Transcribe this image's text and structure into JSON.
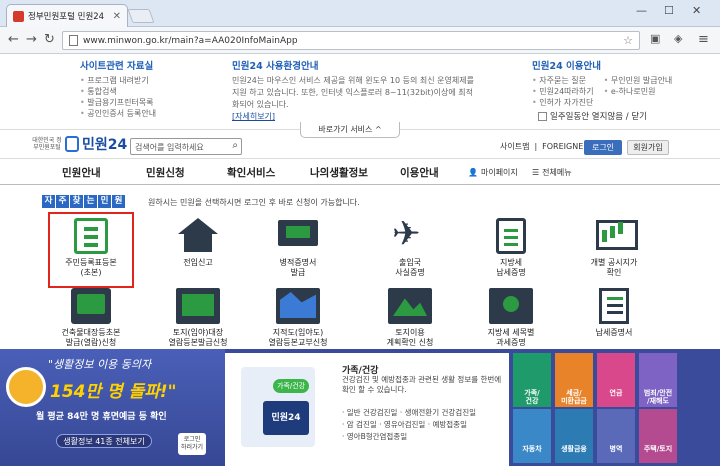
{
  "browser": {
    "tab_title": "정부민원포털 민원24",
    "url": "www.minwon.go.kr/main?a=AA020InfoMainApp"
  },
  "notice": {
    "site_materials": {
      "title": "사이트관련 자료실",
      "items": [
        "프로그램 내려받기",
        "통합검색",
        "발급용기프린터목록",
        "공인인증서 등록안내"
      ]
    },
    "env_guide": {
      "title": "민원24 사용환경안내",
      "text": "민원24는 마우스인 서비스 제공을 위해 윈도우 10 등의 최신 운영체제를 지원 하고 있습니다. 또한, 인터넷 익스플로러 8~11(32bit)이상에 최적화되어 있습니다.",
      "link": "[자세히보기]"
    },
    "usage_guide": {
      "title": "민원24 이용안내",
      "items_left": [
        "자주묻는 질문",
        "민원24따라하기",
        "인허가 자가진단"
      ],
      "items_right": [
        "무인민원 발급안내",
        "e-하나로민원"
      ]
    },
    "hide_today": "일주일동안 열지않음 / 닫기",
    "shortcut_service": "바로가기 서비스"
  },
  "header": {
    "logo_sub": "대한민국 정부민원포털",
    "logo_name": "민원24",
    "search_placeholder": "검색어를 입력하세요",
    "sitemap": "사이트맵",
    "foreigner": "FOREIGNER",
    "login": "로그인",
    "join": "회원가입"
  },
  "gnb": {
    "menus": [
      "민원안내",
      "민원신청",
      "확인서비스",
      "나의생활정보",
      "이용안내"
    ],
    "mypage": "마이페이지",
    "all_menu": "전체메뉴"
  },
  "frequent": {
    "title_chars": [
      "자",
      "주",
      "찾",
      "는",
      "민",
      "원"
    ],
    "desc": "원하시는 민원을 선택하시면 로그인 후 바로 신청이 가능합니다.",
    "row1": [
      {
        "label": "주민등록표등본\n(초본)",
        "icon": "resident-doc-icon"
      },
      {
        "label": "전입신고",
        "icon": "house-icon"
      },
      {
        "label": "병적증명서\n발급",
        "icon": "military-certificate-icon"
      },
      {
        "label": "출입국\n사실증명",
        "icon": "airplane-icon"
      },
      {
        "label": "지방세\n납세증명",
        "icon": "tax-clipboard-icon"
      },
      {
        "label": "개별 공시지가\n확인",
        "icon": "land-price-chart-icon"
      }
    ],
    "row2": [
      {
        "label": "건축물대장등초본\n발급(열람)신청",
        "icon": "building-register-icon"
      },
      {
        "label": "토지(임야)대장\n열람등본발급신청",
        "icon": "land-register-icon"
      },
      {
        "label": "지적도(임야도)\n열람등본교부신청",
        "icon": "cadastral-map-icon"
      },
      {
        "label": "토지이용\n계획확인 신청",
        "icon": "land-use-icon"
      },
      {
        "label": "지방세 세목별\n과세증명",
        "icon": "tax-money-icon"
      },
      {
        "label": "납세증명서",
        "icon": "tax-paper-icon"
      }
    ]
  },
  "banner": {
    "headline": "\"생활정보 이용 동의자",
    "count": "154만 명 돌파!\"",
    "monthly": "월 평균 84만 명 휴면예금 등 확인",
    "button": "생활정보 41종 전체보기",
    "tag": "로그인\n하러가기"
  },
  "info": {
    "title": "가족/건강",
    "badge": "가족/건강",
    "screen_label": "민원24",
    "desc": "건강검진 및 예방접종과 관련된 생활 정보를 한번에 확인 할 수 있습니다.",
    "links": [
      "· 일반 건강검진일",
      "· 생애전환기 건강검진일",
      "· 암 검진일",
      "· 영유아검진일",
      "· 예방접종일",
      "· 영아B형간염접종일"
    ]
  },
  "tiles": [
    {
      "label": "가족/\n건강",
      "color": "#1f9a6b"
    },
    {
      "label": "세금/\n미환급금",
      "color": "#e8832a"
    },
    {
      "label": "연금",
      "color": "#d9488a"
    },
    {
      "label": "범죄/안전\n/재해도",
      "color": "#7e63c4"
    },
    {
      "label": "자동차",
      "color": "#3a88c8"
    },
    {
      "label": "생활금융",
      "color": "#2d7bb3"
    },
    {
      "label": "병역",
      "color": "#5a6ab8"
    },
    {
      "label": "주택/토지",
      "color": "#b44a8f"
    }
  ]
}
